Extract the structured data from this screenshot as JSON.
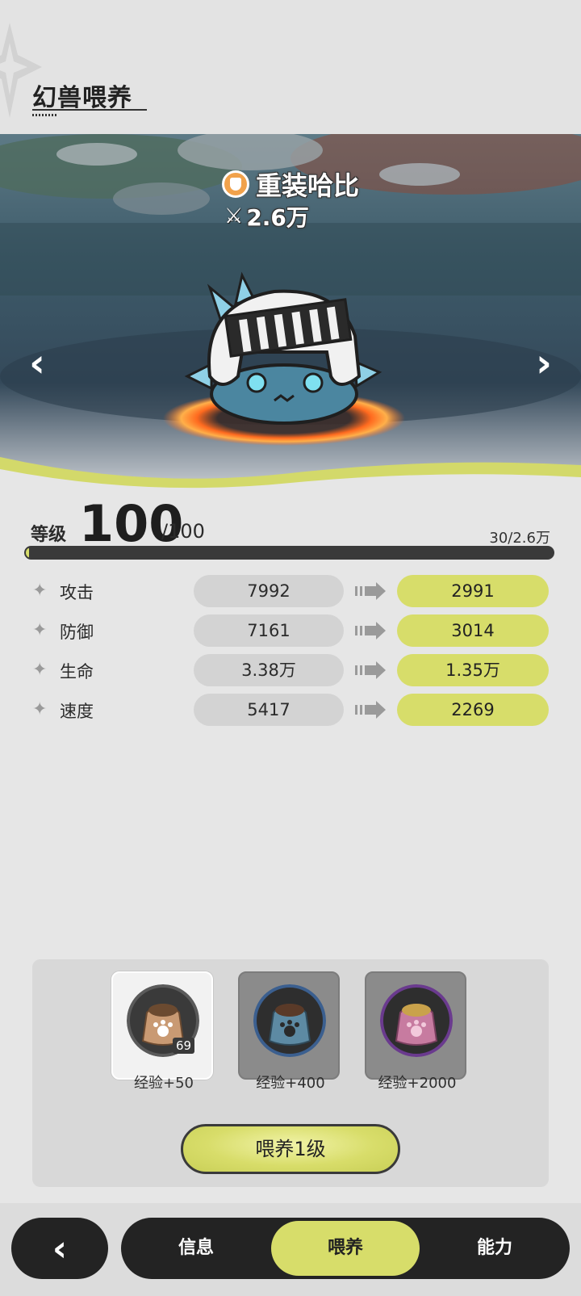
{
  "header": {
    "title": "幻兽喂养"
  },
  "pet": {
    "name": "重装哈比",
    "power": "2.6万",
    "power_icon": "crossed-swords-icon",
    "rarity_icon": "shield-badge-icon"
  },
  "level": {
    "label": "等级",
    "value": "100",
    "max": "/100",
    "exp": "30/2.6万",
    "exp_fraction": 0.001
  },
  "stats": [
    {
      "name": "攻击",
      "current": "7992",
      "add": "2991"
    },
    {
      "name": "防御",
      "current": "7161",
      "add": "3014"
    },
    {
      "name": "生命",
      "current": "3.38万",
      "add": "1.35万"
    },
    {
      "name": "速度",
      "current": "5417",
      "add": "2269"
    }
  ],
  "foods": [
    {
      "label": "经验+50",
      "count": "69",
      "ring_color": "#5a5a5a",
      "sack_color": "#c99a73"
    },
    {
      "label": "经验+400",
      "count": "",
      "ring_color": "#3b5f8f",
      "sack_color": "#5d8aa3"
    },
    {
      "label": "经验+2000",
      "count": "",
      "ring_color": "#6a3a8e",
      "sack_color": "#c77ba0"
    }
  ],
  "feed_button": "喂养1级",
  "tabs": [
    {
      "label": "信息"
    },
    {
      "label": "喂养"
    },
    {
      "label": "能力"
    }
  ],
  "colors": {
    "accent": "#d7dd6a",
    "dark": "#232323"
  }
}
